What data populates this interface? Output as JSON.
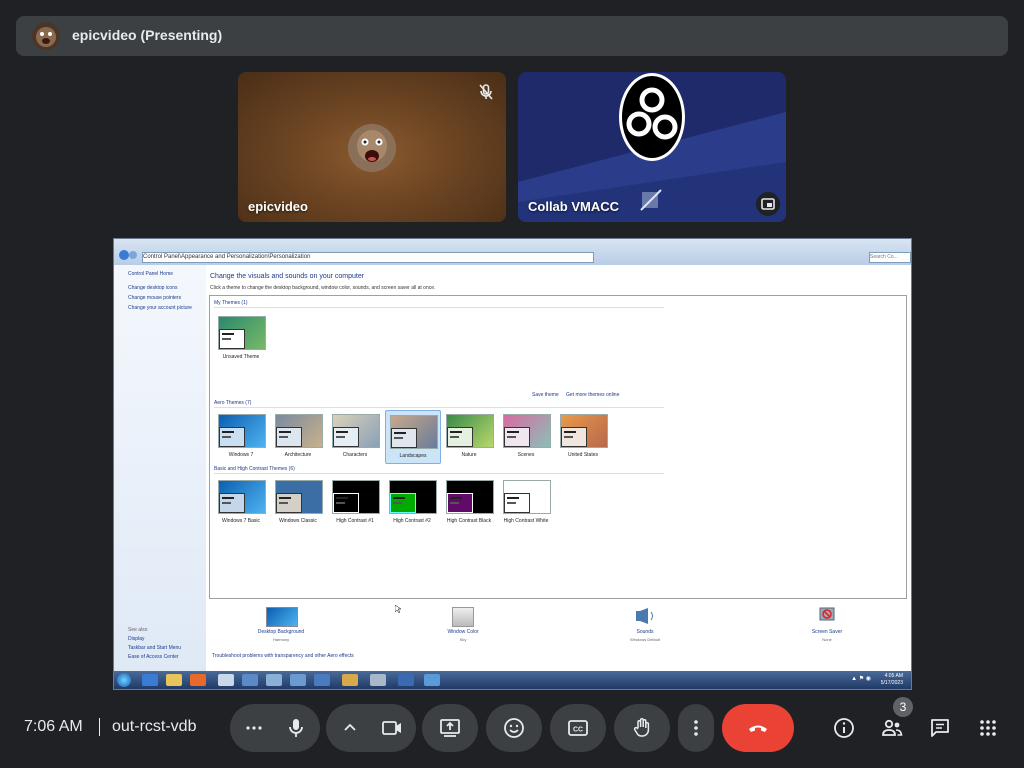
{
  "banner": {
    "presenter_text": "epicvideo (Presenting)"
  },
  "tiles": [
    {
      "name": "epicvideo",
      "muted": true
    },
    {
      "name": "Collab VMACC",
      "camera_off": true
    }
  ],
  "share": {
    "address": "Control Panel\\Appearance and Personalization\\Personalization",
    "search_placeholder": "Search Co...",
    "left_links": [
      "Control Panel Home",
      "Change desktop icons",
      "Change mouse pointers",
      "Change your account picture"
    ],
    "left_bottom_links": [
      "See also",
      "Display",
      "Taskbar and Start Menu",
      "Ease of Access Center"
    ],
    "title": "Change the visuals and sounds on your computer",
    "description": "Click a theme to change the desktop background, window color, sounds, and screen saver all at once.",
    "groups": {
      "my_themes": "My Themes (1)",
      "aero_themes": "Aero Themes (7)",
      "basic_themes": "Basic and High Contrast Themes (6)"
    },
    "links": {
      "save_theme": "Save theme",
      "get_more": "Get more themes online"
    },
    "my_themes": [
      {
        "label": "Unsaved Theme"
      }
    ],
    "aero_themes": [
      {
        "label": "Windows 7"
      },
      {
        "label": "Architecture"
      },
      {
        "label": "Characters"
      },
      {
        "label": "Landscapes"
      },
      {
        "label": "Nature"
      },
      {
        "label": "Scenes"
      },
      {
        "label": "United States"
      }
    ],
    "basic_themes": [
      {
        "label": "Windows 7 Basic"
      },
      {
        "label": "Windows Classic"
      },
      {
        "label": "High Contrast #1"
      },
      {
        "label": "High Contrast #2"
      },
      {
        "label": "High Contrast Black"
      },
      {
        "label": "High Contrast White"
      }
    ],
    "bottom_items": [
      {
        "title": "Desktop Background",
        "sub": "Harmony"
      },
      {
        "title": "Window Color",
        "sub": "Sky"
      },
      {
        "title": "Sounds",
        "sub": "Windows Default"
      },
      {
        "title": "Screen Saver",
        "sub": "None"
      }
    ],
    "troubleshoot": "Troubleshoot problems with transparency and other Aero effects",
    "taskbar_time": "4:05 AM",
    "taskbar_date": "5/17/2023"
  },
  "controls": {
    "time": "7:06 AM",
    "meeting_code": "out-rcst-vdb",
    "people_count": "3"
  },
  "colors": {
    "end_call": "#ea4335",
    "bar": "#3c4043",
    "background": "#202124"
  }
}
